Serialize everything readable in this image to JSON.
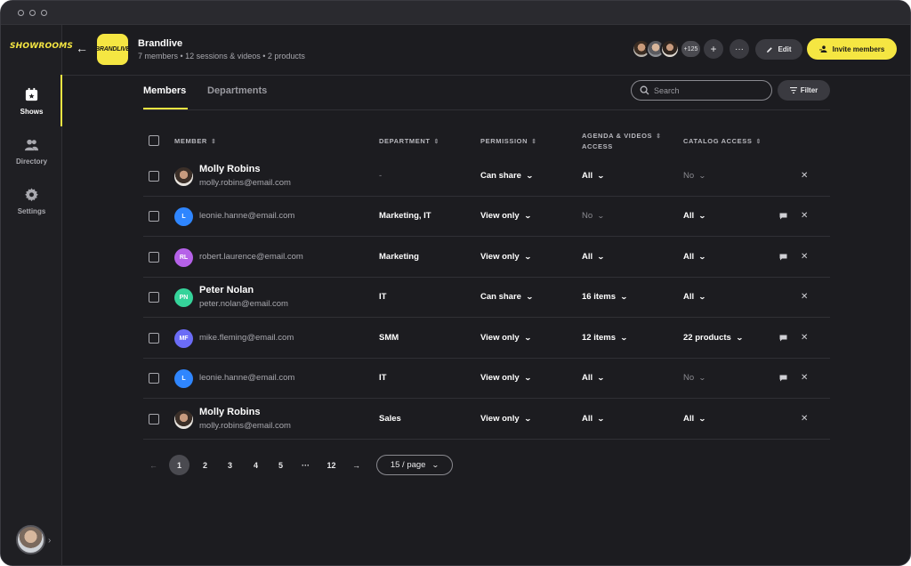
{
  "app": {
    "logo_text": "SHOWROOMS"
  },
  "sidebar": {
    "items": [
      {
        "label": "Shows",
        "icon": "calendar-star-icon",
        "active": true
      },
      {
        "label": "Directory",
        "icon": "people-icon",
        "active": false
      },
      {
        "label": "Settings",
        "icon": "gear-icon",
        "active": false
      }
    ]
  },
  "header": {
    "brand_logo_text": "BRANDLIVE",
    "brand_name": "Brandlive",
    "meta": "7 members • 12 sessions & videos • 2 products",
    "avatar_count": "+125",
    "edit_label": "Edit",
    "invite_label": "Invite members"
  },
  "tabs": [
    {
      "label": "Members",
      "active": true
    },
    {
      "label": "Departments",
      "active": false
    }
  ],
  "search": {
    "placeholder": "Search"
  },
  "filter_label": "Filter",
  "table": {
    "columns": {
      "member": "MEMBER",
      "department": "DEPARTMENT",
      "permission": "PERMISSION",
      "agenda_line1": "AGENDA & VIDEOS",
      "agenda_line2": "ACCESS",
      "catalog": "CATALOG ACCESS"
    },
    "rows": [
      {
        "name": "Molly Robins",
        "email": "molly.robins@email.com",
        "initials": "",
        "department": "-",
        "permission": "Can share",
        "agenda": "All",
        "catalog": "No",
        "catalog_dim": true,
        "agenda_dim": false
      },
      {
        "name": "",
        "email": "leonie.hanne@email.com",
        "initials": "L",
        "department": "Marketing, IT",
        "permission": "View only",
        "agenda": "No",
        "catalog": "All",
        "catalog_dim": false,
        "agenda_dim": true
      },
      {
        "name": "",
        "email": "robert.laurence@email.com",
        "initials": "RL",
        "department": "Marketing",
        "permission": "View only",
        "agenda": "All",
        "catalog": "All",
        "catalog_dim": false,
        "agenda_dim": false
      },
      {
        "name": "Peter Nolan",
        "email": "peter.nolan@email.com",
        "initials": "PN",
        "department": "IT",
        "permission": "Can share",
        "agenda": "16 items",
        "catalog": "All",
        "catalog_dim": false,
        "agenda_dim": false
      },
      {
        "name": "",
        "email": "mike.fleming@email.com",
        "initials": "MF",
        "department": "SMM",
        "permission": "View only",
        "agenda": "12 items",
        "catalog": "22 products",
        "catalog_dim": false,
        "agenda_dim": false
      },
      {
        "name": "",
        "email": "leonie.hanne@email.com",
        "initials": "L",
        "department": "IT",
        "permission": "View only",
        "agenda": "All",
        "catalog": "No",
        "catalog_dim": true,
        "agenda_dim": false
      },
      {
        "name": "Molly Robins",
        "email": "molly.robins@email.com",
        "initials": "",
        "department": "Sales",
        "permission": "View only",
        "agenda": "All",
        "catalog": "All",
        "catalog_dim": false,
        "agenda_dim": false
      }
    ]
  },
  "pagination": {
    "pages": [
      "1",
      "2",
      "3",
      "4",
      "5",
      "···",
      "12"
    ],
    "current": "1",
    "per_page": "15 / page"
  },
  "colors": {
    "accent": "#f5e642",
    "background": "#1c1c20",
    "avatar_blue": "#2f86ff",
    "avatar_purple": "#b561e8",
    "avatar_green": "#35d39a",
    "avatar_indigo": "#6b6cf6"
  }
}
